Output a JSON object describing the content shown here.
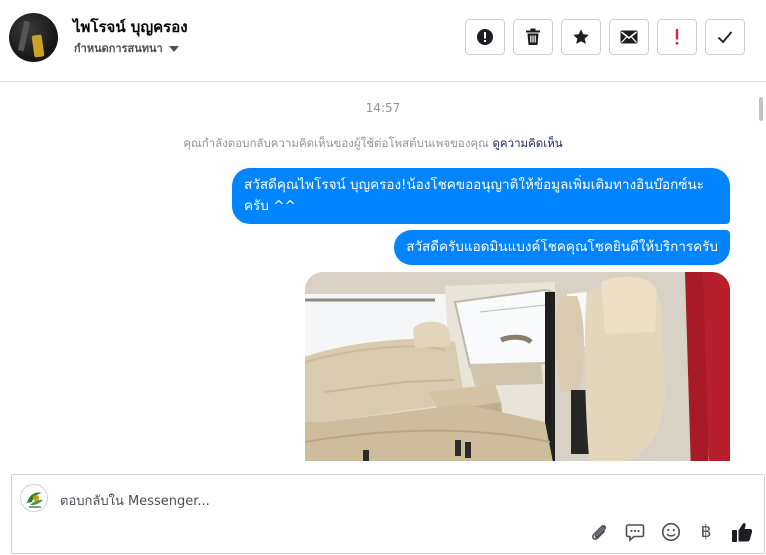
{
  "header": {
    "contact_name": "ไพโรจน์ บุญครอง",
    "assign_label": "กำหนดการสนทนา",
    "actions": [
      {
        "icon": "alert-circle-icon",
        "label": "Mark as spam"
      },
      {
        "icon": "trash-icon",
        "label": "Delete"
      },
      {
        "icon": "star-icon",
        "label": "Star"
      },
      {
        "icon": "envelope-icon",
        "label": "Mark as unread"
      },
      {
        "icon": "exclamation-icon",
        "label": "Follow up"
      },
      {
        "icon": "check-icon",
        "label": "Mark as done"
      }
    ],
    "colors": {
      "flag_red": "#e41e3f"
    }
  },
  "conversation": {
    "timestamp": "14:57",
    "context_text": "คุณกำลังตอบกลับความคิดเห็นของผู้ใช้ต่อโพสต์บนเพจของคุณ",
    "context_link": "ดูความคิดเห็น",
    "messages": [
      {
        "from": "page",
        "text": "สวัสดีคุณไพโรจน์ บุญครอง!น้องโชคขออนุญาติให้ข้อมูลเพิ่มเติมทางอินบ๊อกซ์นะครับ ^^"
      },
      {
        "from": "page",
        "text": "สวัสดีครับแอดมินแบงค์โชคคุณโชคยินดีให้บริการครับ"
      },
      {
        "from": "page",
        "type": "image",
        "image": "car-rear-seat-photo"
      }
    ],
    "colors": {
      "bubble": "#0084ff",
      "bubble_text": "#ffffff"
    }
  },
  "composer": {
    "placeholder": "ตอบกลับใน Messenger...",
    "tools": [
      "paperclip-icon",
      "saved-reply-icon",
      "emoji-icon",
      "baht-icon",
      "thumbs-up-icon"
    ],
    "baht_symbol": "฿"
  }
}
